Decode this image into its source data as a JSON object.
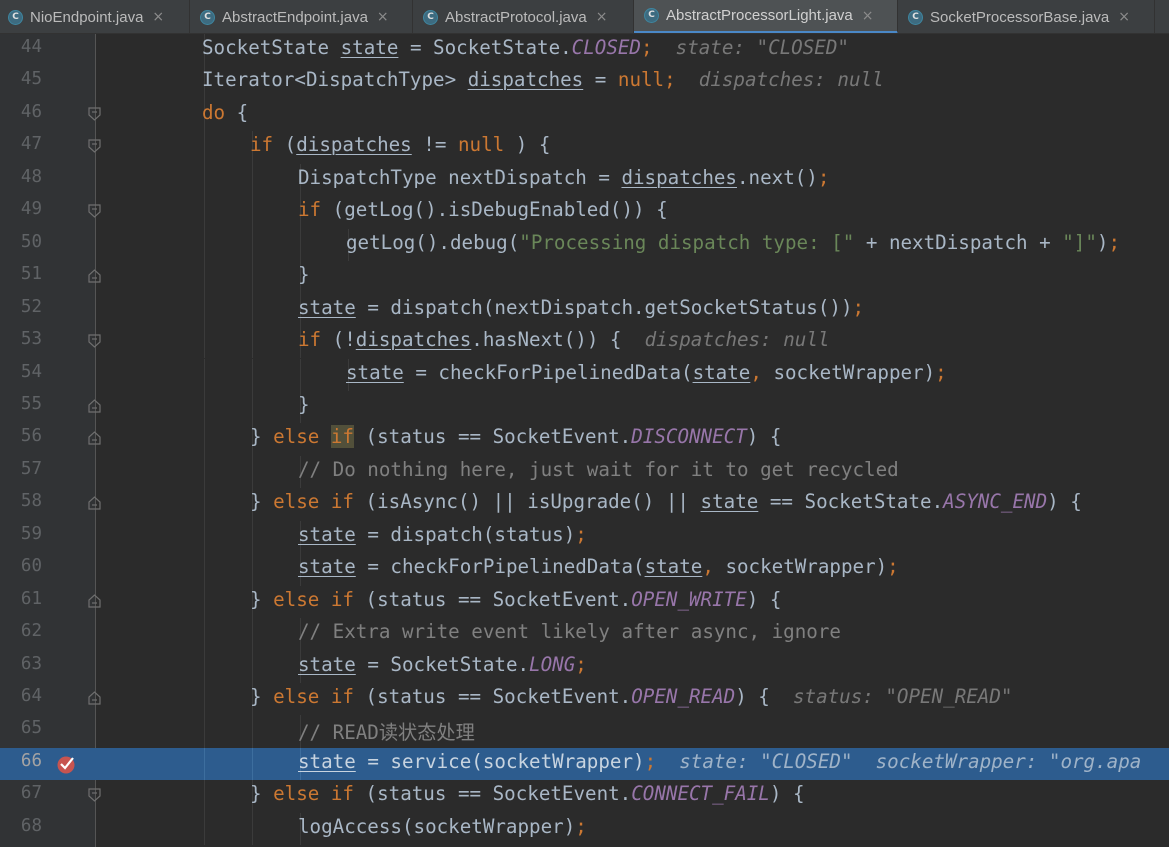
{
  "tabs": [
    {
      "label": "NioEndpoint.java",
      "active": false
    },
    {
      "label": "AbstractEndpoint.java",
      "active": false
    },
    {
      "label": "AbstractProtocol.java",
      "active": false
    },
    {
      "label": "AbstractProcessorLight.java",
      "active": true
    },
    {
      "label": "SocketProcessorBase.java",
      "active": false
    }
  ],
  "tab_icon_letter": "C",
  "tab_close_glyph": "×",
  "editor": {
    "current_line": "66",
    "lines": [
      {
        "n": "44",
        "fold": "none",
        "t": [
          [
            "",
            "SocketState "
          ],
          [
            "ul",
            "state"
          ],
          [
            "",
            " = SocketState."
          ],
          [
            "fld",
            "CLOSED"
          ],
          [
            "kw",
            ";"
          ],
          [
            "hint",
            "  state: \"CLOSED\""
          ]
        ]
      },
      {
        "n": "45",
        "fold": "none",
        "t": [
          [
            "",
            "Iterator<DispatchType> "
          ],
          [
            "ul",
            "dispatches"
          ],
          [
            "",
            " = "
          ],
          [
            "kw",
            "null"
          ],
          [
            "kw",
            ";"
          ],
          [
            "hint",
            "  dispatches: null"
          ]
        ]
      },
      {
        "n": "46",
        "fold": "open",
        "t": [
          [
            "kw",
            "do"
          ],
          [
            "",
            " {"
          ]
        ]
      },
      {
        "n": "47",
        "fold": "open",
        "t": [
          [
            "kw",
            "if"
          ],
          [
            "",
            " ("
          ],
          [
            "ul",
            "dispatches"
          ],
          [
            "",
            " != "
          ],
          [
            "kw",
            "null"
          ],
          [
            "",
            " ) {"
          ]
        ]
      },
      {
        "n": "48",
        "fold": "none",
        "t": [
          [
            "",
            "DispatchType nextDispatch = "
          ],
          [
            "ul",
            "dispatches"
          ],
          [
            "",
            ".next()"
          ],
          [
            "kw",
            ";"
          ]
        ]
      },
      {
        "n": "49",
        "fold": "open",
        "t": [
          [
            "kw",
            "if"
          ],
          [
            "",
            " (getLog().isDebugEnabled()) {"
          ]
        ]
      },
      {
        "n": "50",
        "fold": "none",
        "t": [
          [
            "",
            "getLog().debug("
          ],
          [
            "str",
            "\"Processing dispatch type: [\""
          ],
          [
            "",
            " + nextDispatch + "
          ],
          [
            "str",
            "\"]\""
          ],
          [
            "",
            ")"
          ],
          [
            "kw",
            ";"
          ]
        ]
      },
      {
        "n": "51",
        "fold": "close",
        "t": [
          [
            "",
            "}"
          ]
        ]
      },
      {
        "n": "52",
        "fold": "none",
        "t": [
          [
            "ul",
            "state"
          ],
          [
            "",
            " = dispatch(nextDispatch.getSocketStatus())"
          ],
          [
            "kw",
            ";"
          ]
        ]
      },
      {
        "n": "53",
        "fold": "open",
        "t": [
          [
            "kw",
            "if"
          ],
          [
            "",
            " (!"
          ],
          [
            "ul",
            "dispatches"
          ],
          [
            "",
            ".hasNext()) {"
          ],
          [
            "hint",
            "  dispatches: null"
          ]
        ]
      },
      {
        "n": "54",
        "fold": "none",
        "t": [
          [
            "ul",
            "state"
          ],
          [
            "",
            " = checkForPipelinedData("
          ],
          [
            "ul",
            "state"
          ],
          [
            "kw",
            ","
          ],
          [
            "",
            " socketWrapper)"
          ],
          [
            "kw",
            ";"
          ]
        ]
      },
      {
        "n": "55",
        "fold": "close",
        "t": [
          [
            "",
            "}"
          ]
        ]
      },
      {
        "n": "56",
        "fold": "close",
        "t": [
          [
            "",
            "} "
          ],
          [
            "kw",
            "else "
          ],
          [
            "kwhl",
            "if"
          ],
          [
            "",
            " (status == SocketEvent."
          ],
          [
            "fld",
            "DISCONNECT"
          ],
          [
            "",
            ") {"
          ]
        ]
      },
      {
        "n": "57",
        "fold": "none",
        "t": [
          [
            "cmt",
            "// Do nothing here, just wait for it to get recycled"
          ]
        ]
      },
      {
        "n": "58",
        "fold": "close",
        "t": [
          [
            "",
            "} "
          ],
          [
            "kw",
            "else if"
          ],
          [
            "",
            " (isAsync() || isUpgrade() || "
          ],
          [
            "ul",
            "state"
          ],
          [
            "",
            " == SocketState."
          ],
          [
            "fld",
            "ASYNC_END"
          ],
          [
            "",
            ") {"
          ]
        ]
      },
      {
        "n": "59",
        "fold": "none",
        "t": [
          [
            "ul",
            "state"
          ],
          [
            "",
            " = dispatch(status)"
          ],
          [
            "kw",
            ";"
          ]
        ]
      },
      {
        "n": "60",
        "fold": "none",
        "t": [
          [
            "ul",
            "state"
          ],
          [
            "",
            " = checkForPipelinedData("
          ],
          [
            "ul",
            "state"
          ],
          [
            "kw",
            ","
          ],
          [
            "",
            " socketWrapper)"
          ],
          [
            "kw",
            ";"
          ]
        ]
      },
      {
        "n": "61",
        "fold": "close",
        "t": [
          [
            "",
            "} "
          ],
          [
            "kw",
            "else if"
          ],
          [
            "",
            " (status == SocketEvent."
          ],
          [
            "fld",
            "OPEN_WRITE"
          ],
          [
            "",
            ") {"
          ]
        ]
      },
      {
        "n": "62",
        "fold": "none",
        "t": [
          [
            "cmt",
            "// Extra write event likely after async, ignore"
          ]
        ]
      },
      {
        "n": "63",
        "fold": "none",
        "t": [
          [
            "ul",
            "state"
          ],
          [
            "",
            " = SocketState."
          ],
          [
            "fld",
            "LONG"
          ],
          [
            "kw",
            ";"
          ]
        ]
      },
      {
        "n": "64",
        "fold": "close",
        "t": [
          [
            "",
            "} "
          ],
          [
            "kw",
            "else if"
          ],
          [
            "",
            " (status == SocketEvent."
          ],
          [
            "fld",
            "OPEN_READ"
          ],
          [
            "",
            ") {"
          ],
          [
            "hint",
            "  status: \"OPEN_READ\""
          ]
        ]
      },
      {
        "n": "65",
        "fold": "none",
        "t": [
          [
            "cmt",
            "// READ读状态处理"
          ]
        ]
      },
      {
        "n": "66",
        "fold": "none",
        "bp": true,
        "t": [
          [
            "ul",
            "state"
          ],
          [
            "",
            " = service(socketWrapper)"
          ],
          [
            "kw",
            ";"
          ],
          [
            "hint",
            "  state: \"CLOSED\"  socketWrapper: \"org.apa"
          ]
        ]
      },
      {
        "n": "67",
        "fold": "open",
        "t": [
          [
            "",
            "} "
          ],
          [
            "kw",
            "else if"
          ],
          [
            "",
            " (status == SocketEvent."
          ],
          [
            "fld",
            "CONNECT_FAIL"
          ],
          [
            "",
            ") {"
          ]
        ]
      },
      {
        "n": "68",
        "fold": "none",
        "t": [
          [
            "",
            "logAccess(socketWrapper)"
          ],
          [
            "kw",
            ";"
          ]
        ]
      }
    ]
  },
  "icons": {
    "tab_file": "java-class-icon",
    "tab_close": "close-icon",
    "fold_open": "fold-collapse-icon",
    "fold_close": "fold-end-icon",
    "breakpoint": "breakpoint-checked-icon"
  },
  "colors": {
    "keyword": "#cc7832",
    "field": "#9876aa",
    "string": "#6a8759",
    "comment": "#808080",
    "text": "#a9b7c6",
    "current_line": "#2d5c8e",
    "background": "#2b2b2b"
  }
}
